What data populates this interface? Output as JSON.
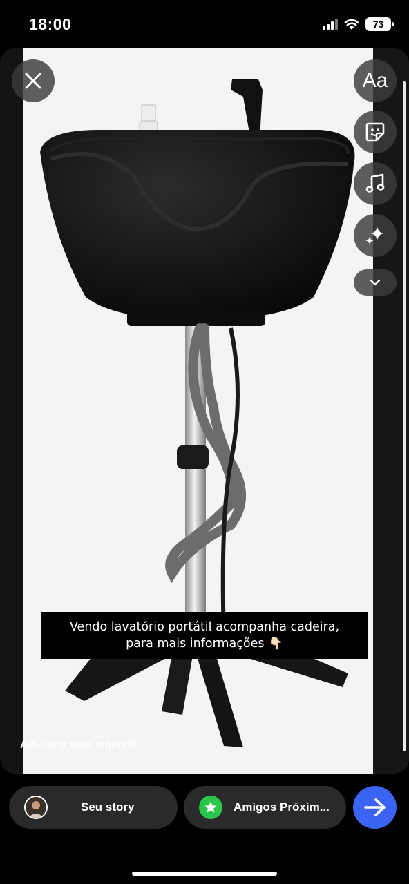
{
  "status_bar": {
    "time": "18:00",
    "battery": "73"
  },
  "editor_tools": {
    "close_icon": "close-icon",
    "text_label": "Aa",
    "sticker_icon": "sticker-icon",
    "music_icon": "music-icon",
    "effects_icon": "sparkles-icon",
    "more_icon": "chevron-down-icon"
  },
  "caption": {
    "line1": "Vendo lavatório portátil acompanha cadeira,",
    "line2": "para mais informações 👇🏻"
  },
  "add_caption_placeholder": "Adicione uma legenda...",
  "share": {
    "your_story_label": "Seu story",
    "close_friends_label": "Amigos Próxim...",
    "send_icon": "arrow-right-icon"
  },
  "colors": {
    "send_button": "#3b64f4",
    "close_friends_badge": "#2ac54c",
    "pill_background": "#2a2a2c"
  }
}
